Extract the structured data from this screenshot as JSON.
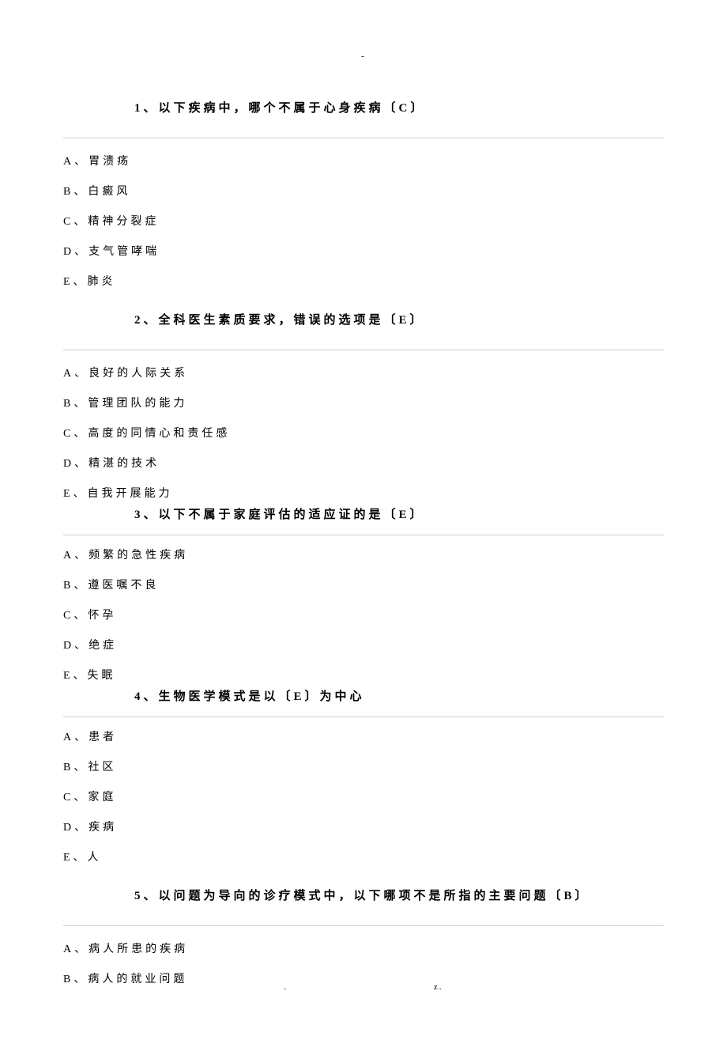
{
  "top_mark": "-",
  "questions": [
    {
      "title": "1、以下疾病中，哪个不属于心身疾病〔C〕",
      "options": [
        "A、胃溃疡",
        "B、白癜风",
        "C、精神分裂症",
        "D、支气管哮喘",
        "E、肺炎"
      ]
    },
    {
      "title": "2、全科医生素质要求，错误的选项是〔E〕",
      "options": [
        "A、良好的人际关系",
        "B、管理团队的能力",
        "C、高度的同情心和责任感",
        "D、精湛的技术",
        "E、自我开展能力"
      ]
    },
    {
      "title": "3、以下不属于家庭评估的适应证的是〔E〕",
      "options": [
        "A、频繁的急性疾病",
        "B、遵医嘱不良",
        "C、怀孕",
        "D、绝症",
        "E、失眠"
      ]
    },
    {
      "title": "4、生物医学模式是以〔E〕为中心",
      "options": [
        "A、患者",
        "B、社区",
        "C、家庭",
        "D、疾病",
        "E、人"
      ]
    },
    {
      "title": "5、以问题为导向的诊疗模式中，以下哪项不是所指的主要问题〔B〕",
      "options": [
        "A、病人所患的疾病",
        "B、病人的就业问题"
      ]
    }
  ],
  "footer_left": ".",
  "footer_right": "z."
}
